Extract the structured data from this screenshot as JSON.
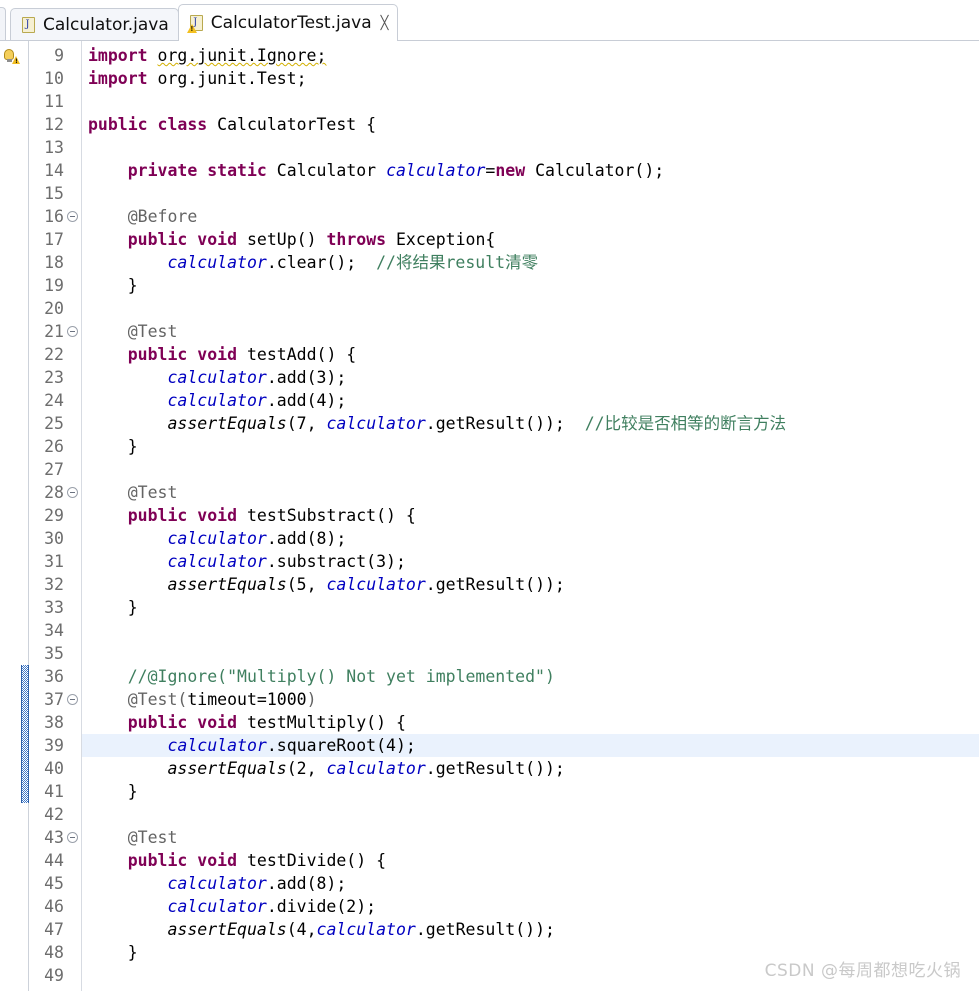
{
  "window": {
    "app": "eclipse-java-editor"
  },
  "tabs": {
    "stub_name": "partial-tab",
    "items": [
      {
        "label": "Calculator.java",
        "icon": "java-file-icon",
        "active": false,
        "closable": false,
        "has_warning": false
      },
      {
        "label": "CalculatorTest.java",
        "icon": "java-file-icon-warning",
        "active": true,
        "closable": true,
        "has_warning": true,
        "close_glyph": "╳"
      }
    ]
  },
  "editor": {
    "first_line": 9,
    "current_line": 39,
    "marker": {
      "line": 9,
      "type": "quickfix-warning-bulb-icon"
    },
    "change_bar": {
      "from_line": 36,
      "to_line": 41
    },
    "fold_lines": [
      16,
      21,
      28,
      37,
      43
    ],
    "lines": [
      {
        "n": 9,
        "tokens": [
          {
            "t": "import ",
            "c": "kw"
          },
          {
            "t": "org.junit.Ignore;",
            "c": "plain warnline"
          }
        ]
      },
      {
        "n": 10,
        "tokens": [
          {
            "t": "import ",
            "c": "kw"
          },
          {
            "t": "org.junit.Test;",
            "c": "plain"
          }
        ]
      },
      {
        "n": 11,
        "tokens": []
      },
      {
        "n": 12,
        "tokens": [
          {
            "t": "public ",
            "c": "kw"
          },
          {
            "t": "class ",
            "c": "kw"
          },
          {
            "t": "CalculatorTest {",
            "c": "plain"
          }
        ]
      },
      {
        "n": 13,
        "tokens": []
      },
      {
        "n": 14,
        "tokens": [
          {
            "t": "    ",
            "c": "plain"
          },
          {
            "t": "private ",
            "c": "kw"
          },
          {
            "t": "static ",
            "c": "kw"
          },
          {
            "t": "Calculator ",
            "c": "plain"
          },
          {
            "t": "calculator",
            "c": "fld"
          },
          {
            "t": "=",
            "c": "plain"
          },
          {
            "t": "new",
            "c": "kw"
          },
          {
            "t": " Calculator();",
            "c": "plain"
          }
        ]
      },
      {
        "n": 15,
        "tokens": []
      },
      {
        "n": 16,
        "tokens": [
          {
            "t": "    ",
            "c": "plain"
          },
          {
            "t": "@Before",
            "c": "ann"
          }
        ]
      },
      {
        "n": 17,
        "tokens": [
          {
            "t": "    ",
            "c": "plain"
          },
          {
            "t": "public ",
            "c": "kw"
          },
          {
            "t": "void ",
            "c": "kw"
          },
          {
            "t": "setUp() ",
            "c": "plain"
          },
          {
            "t": "throws ",
            "c": "kw"
          },
          {
            "t": "Exception{",
            "c": "plain"
          }
        ]
      },
      {
        "n": 18,
        "tokens": [
          {
            "t": "        ",
            "c": "plain"
          },
          {
            "t": "calculator",
            "c": "fld"
          },
          {
            "t": ".clear();  ",
            "c": "plain"
          },
          {
            "t": "//将结果result清零",
            "c": "cmt"
          }
        ]
      },
      {
        "n": 19,
        "tokens": [
          {
            "t": "    }",
            "c": "plain"
          }
        ]
      },
      {
        "n": 20,
        "tokens": []
      },
      {
        "n": 21,
        "tokens": [
          {
            "t": "    ",
            "c": "plain"
          },
          {
            "t": "@Test",
            "c": "ann"
          }
        ]
      },
      {
        "n": 22,
        "tokens": [
          {
            "t": "    ",
            "c": "plain"
          },
          {
            "t": "public ",
            "c": "kw"
          },
          {
            "t": "void ",
            "c": "kw"
          },
          {
            "t": "testAdd() {",
            "c": "plain"
          }
        ]
      },
      {
        "n": 23,
        "tokens": [
          {
            "t": "        ",
            "c": "plain"
          },
          {
            "t": "calculator",
            "c": "fld"
          },
          {
            "t": ".add(3);",
            "c": "plain"
          }
        ]
      },
      {
        "n": 24,
        "tokens": [
          {
            "t": "        ",
            "c": "plain"
          },
          {
            "t": "calculator",
            "c": "fld"
          },
          {
            "t": ".add(4);",
            "c": "plain"
          }
        ]
      },
      {
        "n": 25,
        "tokens": [
          {
            "t": "        ",
            "c": "plain"
          },
          {
            "t": "assertEquals",
            "c": "stm"
          },
          {
            "t": "(7, ",
            "c": "plain"
          },
          {
            "t": "calculator",
            "c": "fld"
          },
          {
            "t": ".getResult());  ",
            "c": "plain"
          },
          {
            "t": "//比较是否相等的断言方法",
            "c": "cmt"
          }
        ]
      },
      {
        "n": 26,
        "tokens": [
          {
            "t": "    }",
            "c": "plain"
          }
        ]
      },
      {
        "n": 27,
        "tokens": []
      },
      {
        "n": 28,
        "tokens": [
          {
            "t": "    ",
            "c": "plain"
          },
          {
            "t": "@Test",
            "c": "ann"
          }
        ]
      },
      {
        "n": 29,
        "tokens": [
          {
            "t": "    ",
            "c": "plain"
          },
          {
            "t": "public ",
            "c": "kw"
          },
          {
            "t": "void ",
            "c": "kw"
          },
          {
            "t": "testSubstract() {",
            "c": "plain"
          }
        ]
      },
      {
        "n": 30,
        "tokens": [
          {
            "t": "        ",
            "c": "plain"
          },
          {
            "t": "calculator",
            "c": "fld"
          },
          {
            "t": ".add(8);",
            "c": "plain"
          }
        ]
      },
      {
        "n": 31,
        "tokens": [
          {
            "t": "        ",
            "c": "plain"
          },
          {
            "t": "calculator",
            "c": "fld"
          },
          {
            "t": ".substract(3);",
            "c": "plain"
          }
        ]
      },
      {
        "n": 32,
        "tokens": [
          {
            "t": "        ",
            "c": "plain"
          },
          {
            "t": "assertEquals",
            "c": "stm"
          },
          {
            "t": "(5, ",
            "c": "plain"
          },
          {
            "t": "calculator",
            "c": "fld"
          },
          {
            "t": ".getResult());",
            "c": "plain"
          }
        ]
      },
      {
        "n": 33,
        "tokens": [
          {
            "t": "    }",
            "c": "plain"
          }
        ]
      },
      {
        "n": 34,
        "tokens": []
      },
      {
        "n": 35,
        "tokens": []
      },
      {
        "n": 36,
        "tokens": [
          {
            "t": "    ",
            "c": "plain"
          },
          {
            "t": "//@Ignore(\"Multiply() Not yet implemented\")",
            "c": "cmt"
          }
        ]
      },
      {
        "n": 37,
        "tokens": [
          {
            "t": "    ",
            "c": "plain"
          },
          {
            "t": "@Test",
            "c": "ann"
          },
          {
            "t": "(",
            "c": "ann"
          },
          {
            "t": "timeout=1000",
            "c": "plain"
          },
          {
            "t": ")",
            "c": "ann"
          }
        ]
      },
      {
        "n": 38,
        "tokens": [
          {
            "t": "    ",
            "c": "plain"
          },
          {
            "t": "public ",
            "c": "kw"
          },
          {
            "t": "void ",
            "c": "kw"
          },
          {
            "t": "testMultiply() {",
            "c": "plain"
          }
        ]
      },
      {
        "n": 39,
        "tokens": [
          {
            "t": "        ",
            "c": "plain"
          },
          {
            "t": "calculator",
            "c": "fld"
          },
          {
            "t": ".squareRoot(4);",
            "c": "plain"
          }
        ]
      },
      {
        "n": 40,
        "tokens": [
          {
            "t": "        ",
            "c": "plain"
          },
          {
            "t": "assertEquals",
            "c": "stm"
          },
          {
            "t": "(2, ",
            "c": "plain"
          },
          {
            "t": "calculator",
            "c": "fld"
          },
          {
            "t": ".getResult());",
            "c": "plain"
          }
        ]
      },
      {
        "n": 41,
        "tokens": [
          {
            "t": "    }",
            "c": "plain"
          }
        ]
      },
      {
        "n": 42,
        "tokens": []
      },
      {
        "n": 43,
        "tokens": [
          {
            "t": "    ",
            "c": "plain"
          },
          {
            "t": "@Test",
            "c": "ann"
          }
        ]
      },
      {
        "n": 44,
        "tokens": [
          {
            "t": "    ",
            "c": "plain"
          },
          {
            "t": "public ",
            "c": "kw"
          },
          {
            "t": "void ",
            "c": "kw"
          },
          {
            "t": "testDivide() {",
            "c": "plain"
          }
        ]
      },
      {
        "n": 45,
        "tokens": [
          {
            "t": "        ",
            "c": "plain"
          },
          {
            "t": "calculator",
            "c": "fld"
          },
          {
            "t": ".add(8);",
            "c": "plain"
          }
        ]
      },
      {
        "n": 46,
        "tokens": [
          {
            "t": "        ",
            "c": "plain"
          },
          {
            "t": "calculator",
            "c": "fld"
          },
          {
            "t": ".divide(2);",
            "c": "plain"
          }
        ]
      },
      {
        "n": 47,
        "tokens": [
          {
            "t": "        ",
            "c": "plain"
          },
          {
            "t": "assertEquals",
            "c": "stm"
          },
          {
            "t": "(4,",
            "c": "plain"
          },
          {
            "t": "calculator",
            "c": "fld"
          },
          {
            "t": ".getResult());",
            "c": "plain"
          }
        ]
      },
      {
        "n": 48,
        "tokens": [
          {
            "t": "    }",
            "c": "plain"
          }
        ]
      },
      {
        "n": 49,
        "tokens": []
      }
    ]
  },
  "watermark": {
    "text": "CSDN @每周都想吃火锅"
  },
  "colors": {
    "keyword": "#7f0055",
    "field": "#0000c0",
    "comment": "#3f7f5f",
    "annotation": "#646464",
    "string": "#2a00ff",
    "current_line_highlight": "#eaf2fd",
    "change_bar": "#3f79c8",
    "gutter_text": "#6d6d6d"
  }
}
